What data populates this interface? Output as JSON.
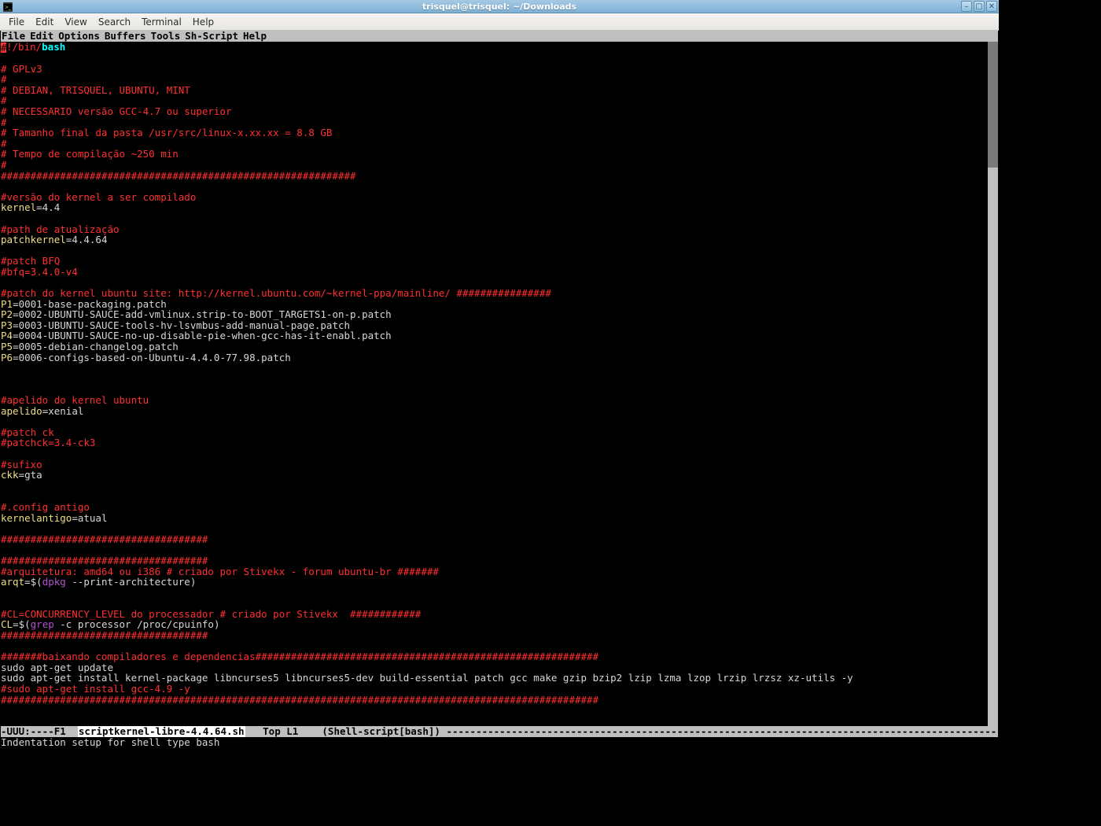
{
  "window": {
    "title": "trisquel@trisquel: ~/Downloads",
    "icon_name": "terminal-icon"
  },
  "titlebar_buttons": {
    "min": "–",
    "max": "▢",
    "close": "✕"
  },
  "app_menu": [
    "File",
    "Edit",
    "View",
    "Search",
    "Terminal",
    "Help"
  ],
  "emacs_menu": [
    "File",
    "Edit",
    "Options",
    "Buffers",
    "Tools",
    "Sh-Script",
    "Help"
  ],
  "modeline": {
    "left": "-UUU:----F1  ",
    "buffer": "scriptkernel-libre-4.4.64.sh",
    "pos": "   Top L1    ",
    "mode": "(Shell-script[bash]) ",
    "dashes": "-----------------------------------------------------------------------------------------------------------------------------"
  },
  "minibuffer": "Indentation setup for shell type bash",
  "code_lines": [
    [
      [
        "cursor",
        "#"
      ],
      [
        "c-red",
        "!/bin/"
      ],
      [
        "c-cyan",
        "bash"
      ]
    ],
    [],
    [
      [
        "c-red",
        "# GPLv3"
      ]
    ],
    [
      [
        "c-red",
        "#"
      ]
    ],
    [
      [
        "c-red",
        "# DEBIAN, TRISQUEL, UBUNTU, MINT"
      ]
    ],
    [
      [
        "c-red",
        "#"
      ]
    ],
    [
      [
        "c-red",
        "# NECESSARIO versão GCC-4.7 ou superior"
      ]
    ],
    [
      [
        "c-red",
        "#"
      ]
    ],
    [
      [
        "c-red",
        "# Tamanho final da pasta /usr/src/linux-x.xx.xx = 8.8 GB"
      ]
    ],
    [
      [
        "c-red",
        "#"
      ]
    ],
    [
      [
        "c-red",
        "# Tempo de compilação ~250 min"
      ]
    ],
    [
      [
        "c-red",
        "#"
      ]
    ],
    [
      [
        "c-red",
        "############################################################"
      ]
    ],
    [],
    [
      [
        "c-red",
        "#versão do kernel a ser compilado"
      ]
    ],
    [
      [
        "c-yellow",
        "kernel"
      ],
      [
        "c-white",
        "=4.4"
      ]
    ],
    [],
    [
      [
        "c-red",
        "#path de atualização"
      ]
    ],
    [
      [
        "c-yellow",
        "patchkernel"
      ],
      [
        "c-white",
        "=4.4.64"
      ]
    ],
    [],
    [
      [
        "c-red",
        "#patch BFQ"
      ]
    ],
    [
      [
        "c-red",
        "#bfq=3.4.0-v4"
      ]
    ],
    [],
    [
      [
        "c-red",
        "#patch do kernel ubuntu site: http://kernel.ubuntu.com/~kernel-ppa/mainline/ ################"
      ]
    ],
    [
      [
        "c-yellow",
        "P1"
      ],
      [
        "c-white",
        "=0001-base-packaging.patch"
      ]
    ],
    [
      [
        "c-yellow",
        "P2"
      ],
      [
        "c-white",
        "=0002-UBUNTU-SAUCE-add-vmlinux.strip-to-BOOT_TARGETS1-on-p.patch"
      ]
    ],
    [
      [
        "c-yellow",
        "P3"
      ],
      [
        "c-white",
        "=0003-UBUNTU-SAUCE-tools-hv-lsvmbus-add-manual-page.patch"
      ]
    ],
    [
      [
        "c-yellow",
        "P4"
      ],
      [
        "c-white",
        "=0004-UBUNTU-SAUCE-no-up-disable-pie-when-gcc-has-it-enabl.patch"
      ]
    ],
    [
      [
        "c-yellow",
        "P5"
      ],
      [
        "c-white",
        "=0005-debian-changelog.patch"
      ]
    ],
    [
      [
        "c-yellow",
        "P6"
      ],
      [
        "c-white",
        "=0006-configs-based-on-Ubuntu-4.4.0-77.98.patch"
      ]
    ],
    [],
    [],
    [],
    [
      [
        "c-red",
        "#apelido do kernel ubuntu"
      ]
    ],
    [
      [
        "c-yellow",
        "apelido"
      ],
      [
        "c-white",
        "=xenial"
      ]
    ],
    [],
    [
      [
        "c-red",
        "#patch ck"
      ]
    ],
    [
      [
        "c-red",
        "#patchck=3.4-ck3"
      ]
    ],
    [],
    [
      [
        "c-red",
        "#sufixo"
      ]
    ],
    [
      [
        "c-yellow",
        "ckk"
      ],
      [
        "c-white",
        "=gta"
      ]
    ],
    [],
    [],
    [
      [
        "c-red",
        "#.config antigo"
      ]
    ],
    [
      [
        "c-yellow",
        "kernelantigo"
      ],
      [
        "c-white",
        "=atual"
      ]
    ],
    [],
    [
      [
        "c-red",
        "###################################"
      ]
    ],
    [],
    [
      [
        "c-red",
        "###################################"
      ]
    ],
    [
      [
        "c-red",
        "#arquitetura: amd64 ou i386 # criado por Stivekx - forum ubuntu-br #######"
      ]
    ],
    [
      [
        "c-yellow",
        "arqt"
      ],
      [
        "c-white",
        "=$("
      ],
      [
        "c-magenta",
        "dpkg"
      ],
      [
        "c-white",
        " --print-architecture)"
      ]
    ],
    [],
    [],
    [
      [
        "c-red",
        "#CL=CONCURRENCY_LEVEL do processador # criado por Stivekx  ############"
      ]
    ],
    [
      [
        "c-yellow",
        "CL"
      ],
      [
        "c-white",
        "=$("
      ],
      [
        "c-magenta",
        "grep"
      ],
      [
        "c-white",
        " -c processor /proc/cpuinfo)"
      ]
    ],
    [
      [
        "c-red",
        "###################################"
      ]
    ],
    [],
    [
      [
        "c-red",
        "#######baixando compiladores e dependencias##########################################################"
      ]
    ],
    [
      [
        "c-white",
        "sudo apt-get update"
      ]
    ],
    [
      [
        "c-white",
        "sudo apt-get install kernel-package libncurses5 libncurses5-dev build-essential patch gcc make gzip bzip2 lzip lzma lzop lrzip lrzsz xz-utils -y"
      ]
    ],
    [
      [
        "c-red",
        "#sudo apt-get install gcc-4.9 -y"
      ]
    ],
    [
      [
        "c-red",
        "#####################################################################################################"
      ]
    ]
  ]
}
